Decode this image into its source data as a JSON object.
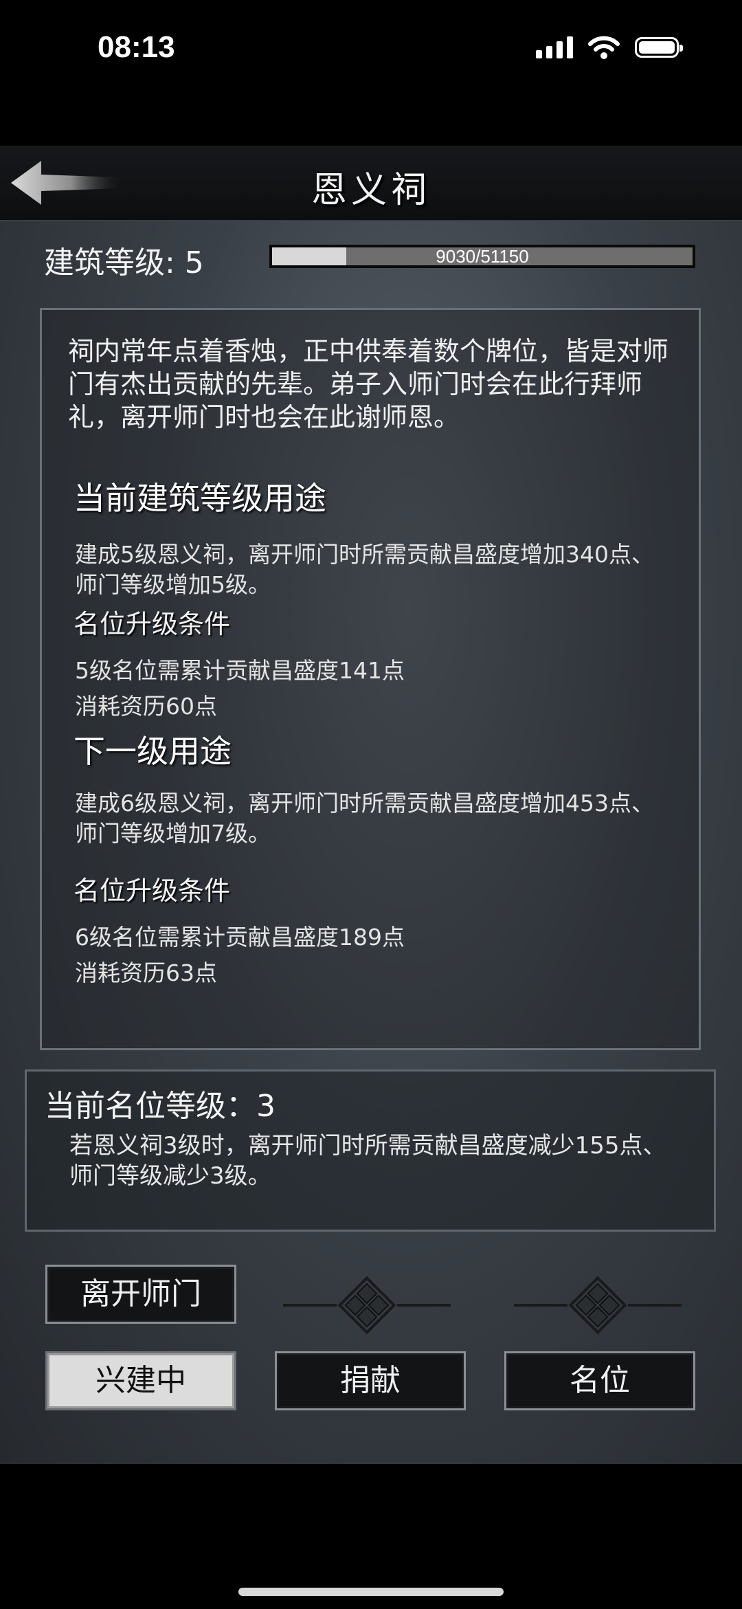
{
  "status_bar": {
    "time": "08:13"
  },
  "header": {
    "title": "恩义祠",
    "back_icon": "back-arrow-icon"
  },
  "building": {
    "level_label": "建筑等级: 5",
    "progress_text": "9030/51150",
    "progress_fraction": 0.1765
  },
  "info": {
    "description": "祠内常年点着香烛，正中供奉着数个牌位，皆是对师门有杰出贡献的先辈。弟子入师门时会在此行拜师礼，离开师门时也会在此谢师恩。",
    "current": {
      "heading": "当前建筑等级用途",
      "text": "建成5级恩义祠，离开师门时所需贡献昌盛度增加340点、师门等级增加5级。",
      "cond_heading": "名位升级条件",
      "cond_line1": "5级名位需累计贡献昌盛度141点",
      "cond_line2": "消耗资历60点"
    },
    "next": {
      "heading": "下一级用途",
      "text": "建成6级恩义祠，离开师门时所需贡献昌盛度增加453点、师门等级增加7级。",
      "cond_heading": "名位升级条件",
      "cond_line1": "6级名位需累计贡献昌盛度189点",
      "cond_line2": "消耗资历63点"
    }
  },
  "rank": {
    "title": "当前名位等级：3",
    "text": "若恩义祠3级时，离开师门时所需贡献昌盛度减少155点、师门等级减少3级。"
  },
  "buttons": {
    "leave": "离开师门",
    "building": "兴建中",
    "donate": "捐献",
    "rank": "名位"
  },
  "colors": {
    "accent_active": "#dcdcdc",
    "panel_border": "#6a7077"
  }
}
